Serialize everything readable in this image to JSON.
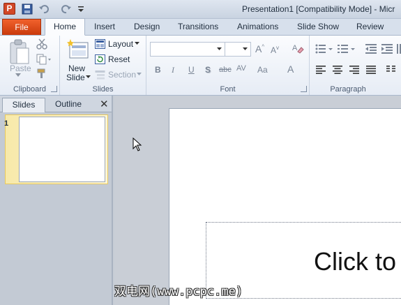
{
  "window": {
    "app_icon_letter": "P",
    "title": "Presentation1 [Compatibility Mode]  -  Micr"
  },
  "tabs": {
    "file": "File",
    "items": [
      "Home",
      "Insert",
      "Design",
      "Transitions",
      "Animations",
      "Slide Show",
      "Review"
    ],
    "active": "Home"
  },
  "ribbon": {
    "clipboard": {
      "label": "Clipboard",
      "paste": "Paste"
    },
    "slides": {
      "label": "Slides",
      "new_slide_line1": "New",
      "new_slide_line2": "Slide",
      "layout": "Layout",
      "reset": "Reset",
      "section": "Section"
    },
    "font": {
      "label": "Font",
      "bold": "B",
      "italic": "I",
      "underline": "U",
      "shadow": "S",
      "strike": "abc",
      "spacing": "AV",
      "case": "Aa",
      "color": "A"
    },
    "paragraph": {
      "label": "Paragraph"
    }
  },
  "panel": {
    "tab_slides": "Slides",
    "tab_outline": "Outline",
    "close": "✕",
    "thumb_number": "1"
  },
  "slide": {
    "placeholder_text": "Click to"
  },
  "watermark": "双电网(www.pcpc.me)",
  "colors": {
    "file_tab": "#e2521d",
    "selection": "#f7e9a9",
    "ribbon_bg": "#f4f7fb"
  }
}
